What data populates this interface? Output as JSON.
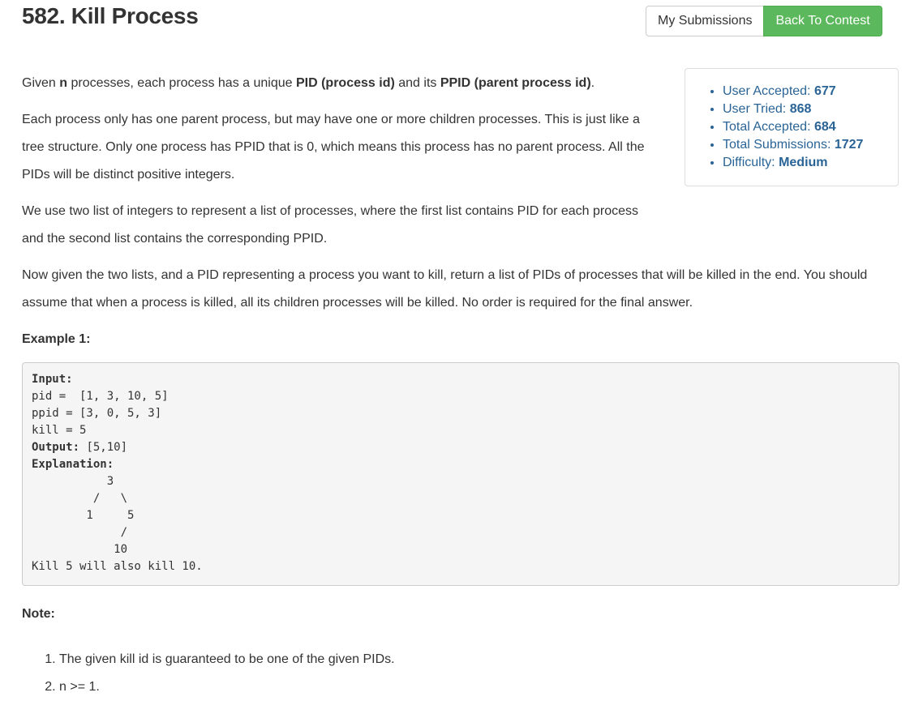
{
  "header": {
    "title": "582. Kill Process",
    "my_submissions_label": "My Submissions",
    "back_to_contest_label": "Back To Contest"
  },
  "stats": {
    "user_accepted_label": "User Accepted: ",
    "user_accepted_value": "677",
    "user_tried_label": "User Tried: ",
    "user_tried_value": "868",
    "total_accepted_label": "Total Accepted: ",
    "total_accepted_value": "684",
    "total_submissions_label": "Total Submissions: ",
    "total_submissions_value": "1727",
    "difficulty_label": "Difficulty: ",
    "difficulty_value": "Medium"
  },
  "description": {
    "p1_a": "Given ",
    "p1_n": "n",
    "p1_b": " processes, each process has a unique ",
    "p1_pid": "PID (process id)",
    "p1_c": " and its ",
    "p1_ppid": "PPID (parent process id)",
    "p1_d": ".",
    "p2": "Each process only has one parent process, but may have one or more children processes. This is just like a tree structure. Only one process has PPID that is 0, which means this process has no parent process. All the PIDs will be distinct positive integers.",
    "p3": "We use two list of integers to represent a list of processes, where the first list contains PID for each process and the second list contains the corresponding PPID.",
    "p4": "Now given the two lists, and a PID representing a process you want to kill, return a list of PIDs of processes that will be killed in the end. You should assume that when a process is killed, all its children processes will be killed. No order is required for the final answer."
  },
  "example": {
    "heading": "Example 1:",
    "input_label": "Input:",
    "input_lines": "pid =  [1, 3, 10, 5]\nppid = [3, 0, 5, 3]\nkill = 5",
    "output_label": "Output:",
    "output_value": " [5,10]",
    "explanation_label": "Explanation:",
    "explanation_tree": "           3\n         /   \\\n        1     5\n             /\n            10\nKill 5 will also kill 10."
  },
  "note": {
    "heading": "Note:",
    "items": [
      "The given kill id is guaranteed to be one of the given PIDs.",
      "n >= 1."
    ]
  }
}
